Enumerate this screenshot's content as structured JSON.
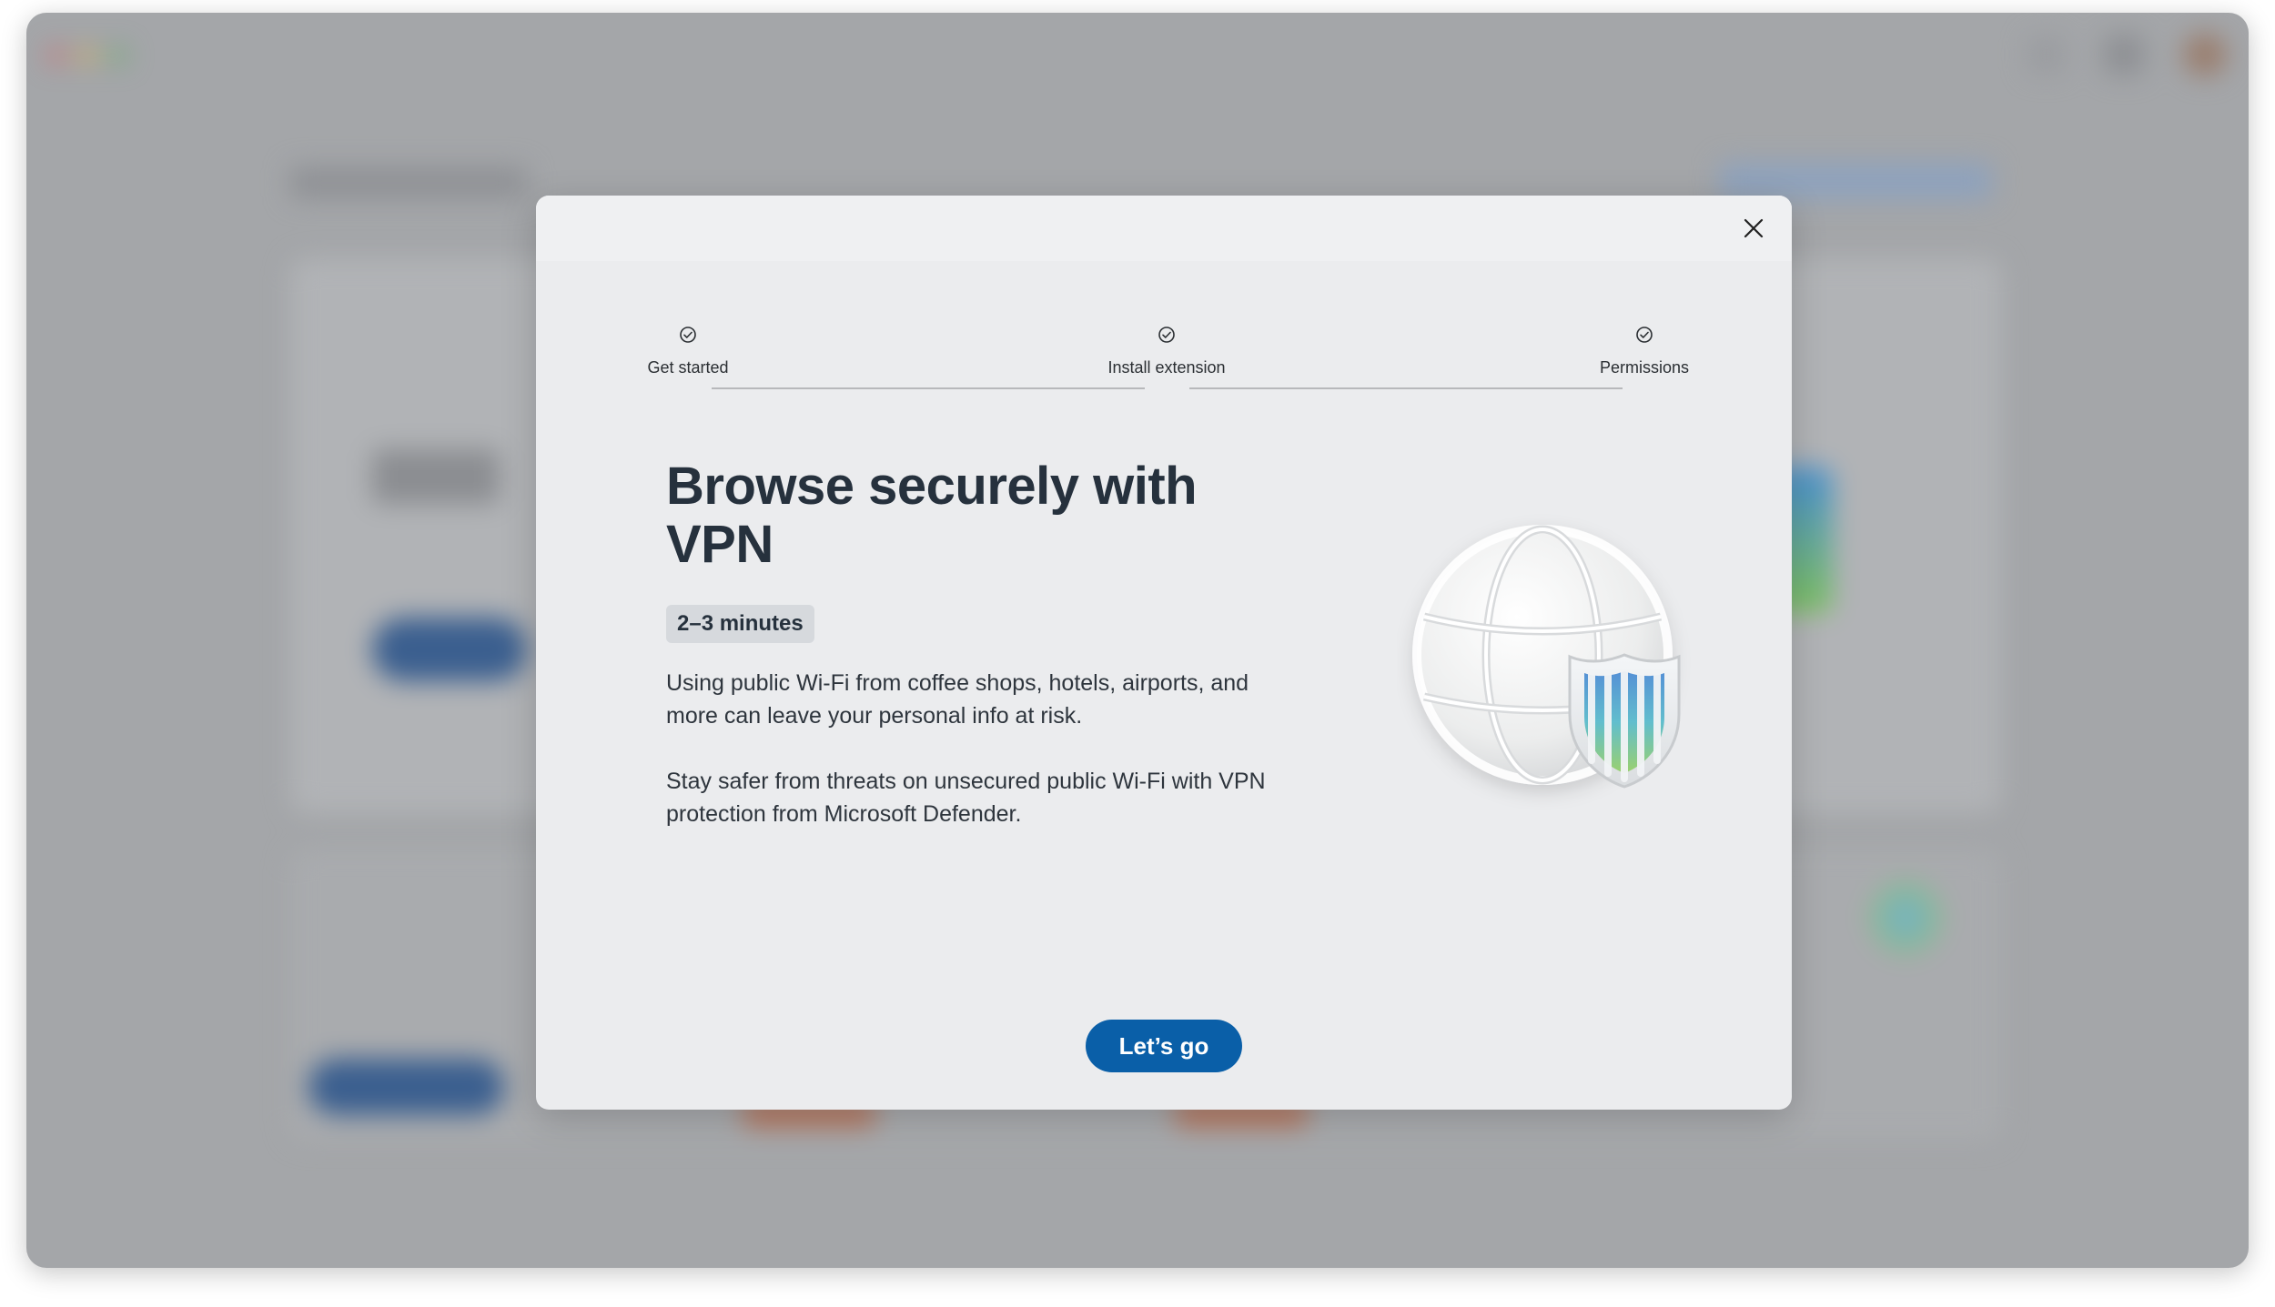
{
  "colors": {
    "accent": "#0a5fa8",
    "title": "#26313d",
    "modal_background": "#ebecee",
    "badge_background": "#d6d9dd"
  },
  "modal": {
    "close_icon": "close-icon",
    "stepper": {
      "steps": [
        {
          "label": "Get started",
          "icon": "check-circle-icon"
        },
        {
          "label": "Install extension",
          "icon": "check-circle-icon"
        },
        {
          "label": "Permissions",
          "icon": "check-circle-icon"
        }
      ]
    },
    "title": "Browse securely with VPN",
    "duration": "2–3 minutes",
    "paragraphs": [
      "Using public Wi-Fi from coffee shops, hotels, airports, and more can leave your personal info at risk.",
      "Stay safer from threats on unsecured public Wi-Fi with VPN protection from Microsoft Defender."
    ],
    "illustration": "globe-shield-icon",
    "primary_button": "Let’s go"
  }
}
